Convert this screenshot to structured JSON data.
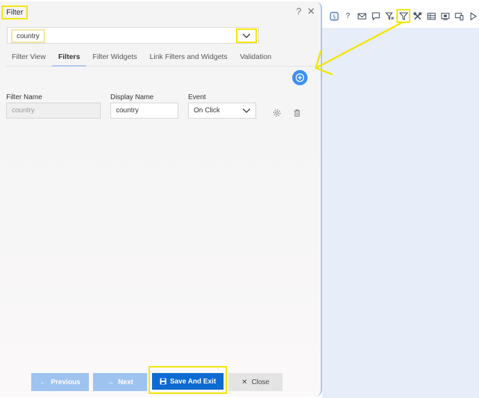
{
  "panel": {
    "title": "Filter",
    "help_icon": "?",
    "close_icon": "✕"
  },
  "filter_select": {
    "value": "country"
  },
  "tabs": [
    {
      "label": "Filter View"
    },
    {
      "label": "Filters"
    },
    {
      "label": "Filter Widgets"
    },
    {
      "label": "Link Filters and Widgets"
    },
    {
      "label": "Validation"
    }
  ],
  "filters_tab": {
    "filter_name_label": "Filter Name",
    "display_name_label": "Display Name",
    "event_label": "Event",
    "row": {
      "filter_name": "country",
      "display_name": "country",
      "event": "On Click"
    }
  },
  "footer": {
    "previous": "Previous",
    "next": "Next",
    "save": "Save And Exit",
    "close": "Close"
  },
  "toolbar": {
    "icons": [
      "refresh-icon",
      "help-icon",
      "mail-icon",
      "comment-icon",
      "clear-filter-icon",
      "filter-icon",
      "tools-icon",
      "table-icon",
      "preview-icon",
      "device-icon",
      "play-icon"
    ]
  },
  "colors": {
    "highlight": "#f3e600",
    "accent": "#0e6bd1",
    "disabled_btn": "#9ec3ef",
    "add_btn": "#3d8ff0"
  }
}
